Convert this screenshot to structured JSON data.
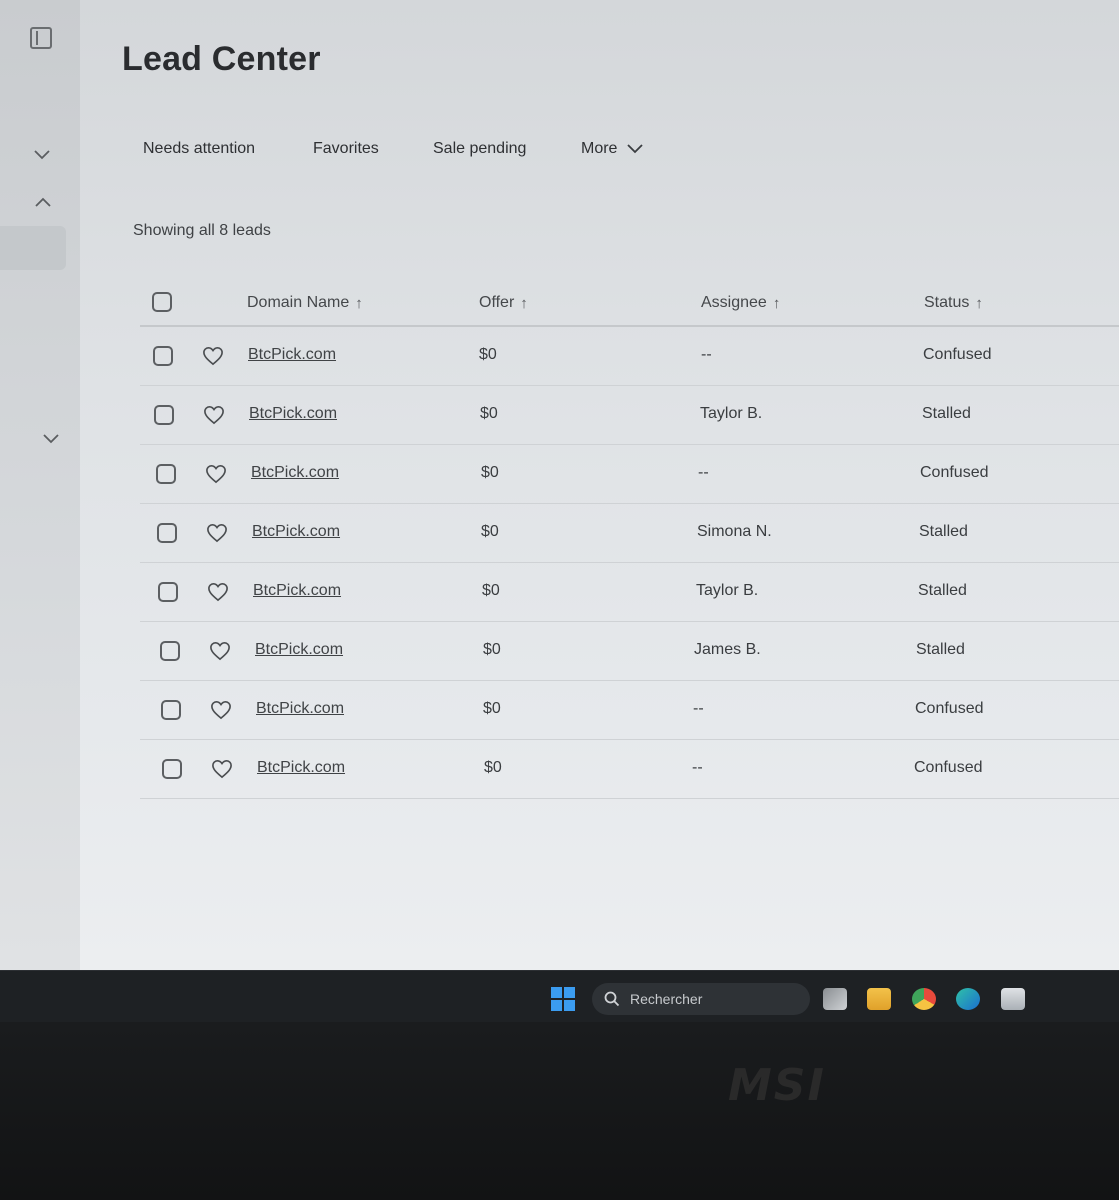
{
  "page": {
    "title": "Lead Center"
  },
  "tabs": [
    {
      "label": "Needs attention"
    },
    {
      "label": "Favorites"
    },
    {
      "label": "Sale pending"
    },
    {
      "label": "More"
    }
  ],
  "summary": "Showing all 8 leads",
  "table": {
    "columns": [
      {
        "label": "Domain Name",
        "sort": "asc"
      },
      {
        "label": "Offer",
        "sort": "asc"
      },
      {
        "label": "Assignee",
        "sort": "asc"
      },
      {
        "label": "Status",
        "sort": "asc"
      }
    ],
    "sort_arrow": "↑",
    "rows": [
      {
        "domain": "BtcPick.com",
        "offer": "$0",
        "assignee": "--",
        "status": "Confused"
      },
      {
        "domain": "BtcPick.com",
        "offer": "$0",
        "assignee": "Taylor B.",
        "status": "Stalled"
      },
      {
        "domain": "BtcPick.com",
        "offer": "$0",
        "assignee": "--",
        "status": "Confused"
      },
      {
        "domain": "BtcPick.com",
        "offer": "$0",
        "assignee": "Simona N.",
        "status": "Stalled"
      },
      {
        "domain": "BtcPick.com",
        "offer": "$0",
        "assignee": "Taylor B.",
        "status": "Stalled"
      },
      {
        "domain": "BtcPick.com",
        "offer": "$0",
        "assignee": "James B.",
        "status": "Stalled"
      },
      {
        "domain": "BtcPick.com",
        "offer": "$0",
        "assignee": "--",
        "status": "Confused"
      },
      {
        "domain": "BtcPick.com",
        "offer": "$0",
        "assignee": "--",
        "status": "Confused"
      }
    ]
  },
  "taskbar": {
    "search_placeholder": "Rechercher",
    "apps": [
      "task-view-icon",
      "file-explorer-icon",
      "chrome-icon",
      "edge-icon",
      "store-icon"
    ]
  },
  "bezel": {
    "brand": "MSI"
  }
}
